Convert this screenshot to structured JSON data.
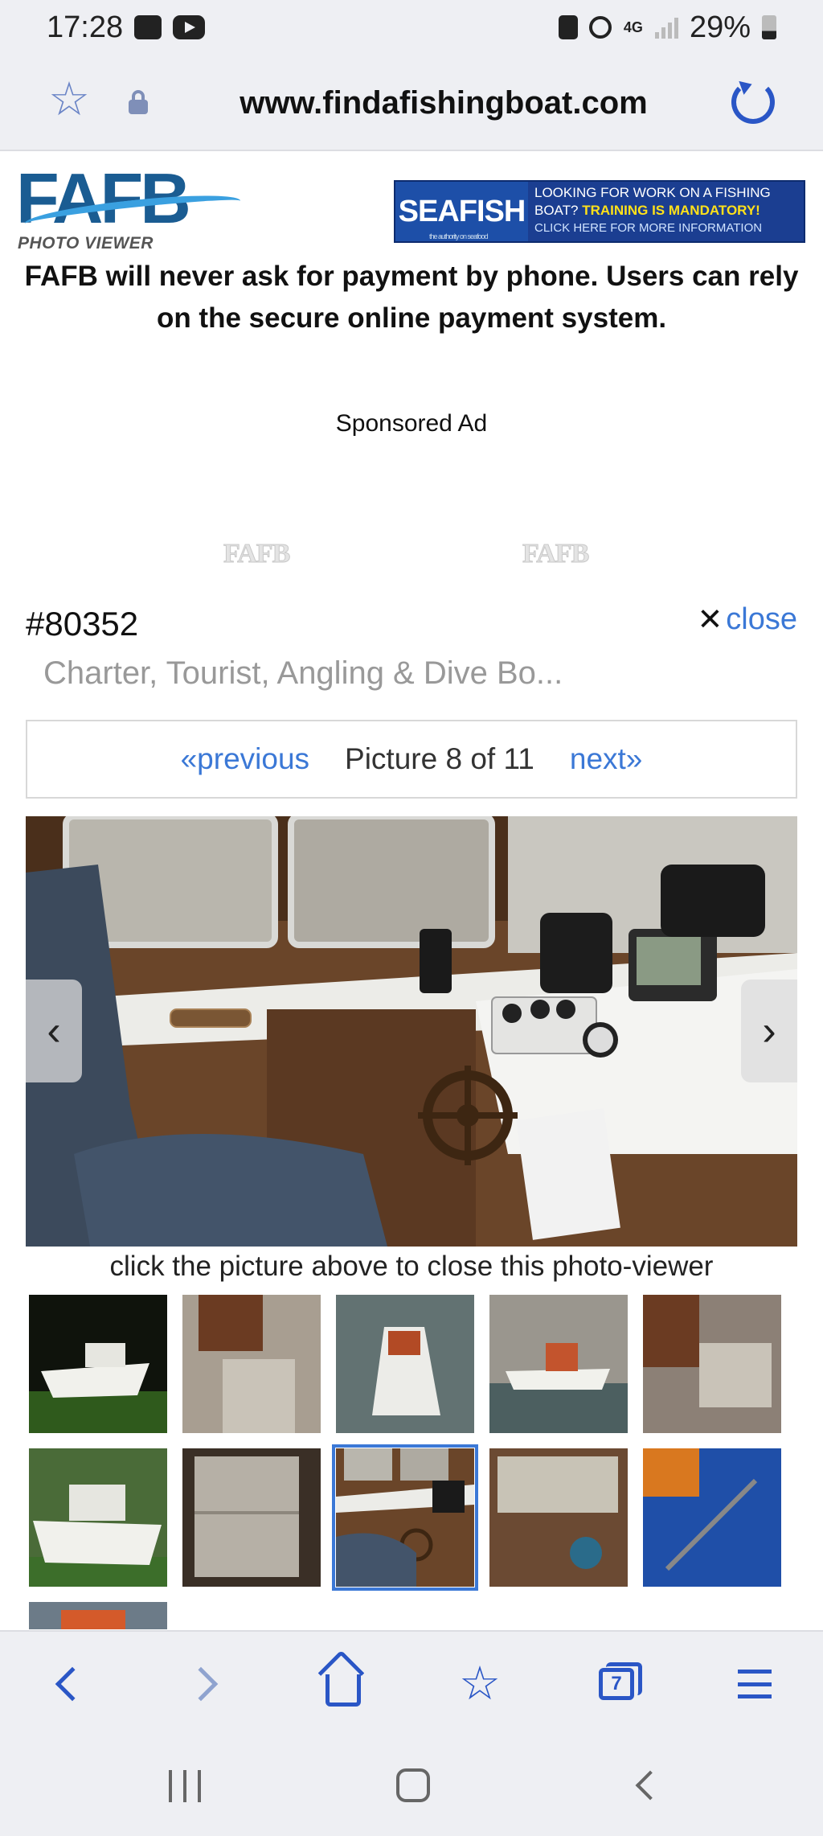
{
  "status_bar": {
    "time": "17:28",
    "network": "4G",
    "battery": "29%"
  },
  "browser": {
    "url": "www.findafishingboat.com"
  },
  "header": {
    "logo_text": "FAFB",
    "logo_subtitle": "PHOTO VIEWER",
    "ad": {
      "brand": "SEAFISH",
      "brand_tagline": "the authority on seafood",
      "line1": "LOOKING FOR WORK ON A FISHING",
      "line2_prefix": "BOAT? ",
      "line2_highlight": "TRAINING IS MANDATORY!",
      "line3": "CLICK HERE FOR MORE INFORMATION"
    }
  },
  "notice": "FAFB will never ask for payment by phone. Users can rely on the secure online payment system.",
  "sponsored_label": "Sponsored Ad",
  "watermark": "FAFB",
  "viewer": {
    "listing_id": "#80352",
    "close_label": "close",
    "title": "Charter, Tourist, Angling & Dive Bo...",
    "prev_label": "«previous",
    "counter": "Picture 8 of 11",
    "next_label": "next»",
    "caption": "click the picture above to close this photo-viewer",
    "current_index": 8,
    "total": 11,
    "thumbnails": [
      {
        "subject": "boat-on-trailer"
      },
      {
        "subject": "deck-box"
      },
      {
        "subject": "boat-moored"
      },
      {
        "subject": "harbour-wall"
      },
      {
        "subject": "cabin-deck"
      },
      {
        "subject": "boat-on-grass"
      },
      {
        "subject": "storage-box"
      },
      {
        "subject": "wheelhouse"
      },
      {
        "subject": "cabin-interior"
      },
      {
        "subject": "blue-deck-gear"
      },
      {
        "subject": "boat-roof"
      }
    ]
  },
  "colors": {
    "link": "#3b78d6",
    "browser_accent": "#2a56c6",
    "bar_bg": "#eeeff3"
  },
  "bottom_bar": {
    "tabs_count": "7"
  }
}
